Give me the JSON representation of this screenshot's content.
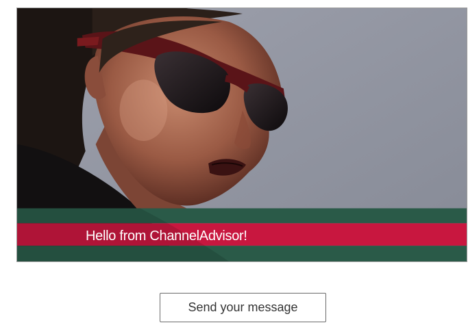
{
  "video": {
    "banner_text": "Hello from ChannelAdvisor!",
    "image_subject": "woman-wearing-sunglasses"
  },
  "actions": {
    "send_label": "Send your message"
  },
  "colors": {
    "background": "#8e919d",
    "stripe_green": "#2a5a48",
    "stripe_red": "#c8173f",
    "button_border": "#6b6b6b"
  }
}
